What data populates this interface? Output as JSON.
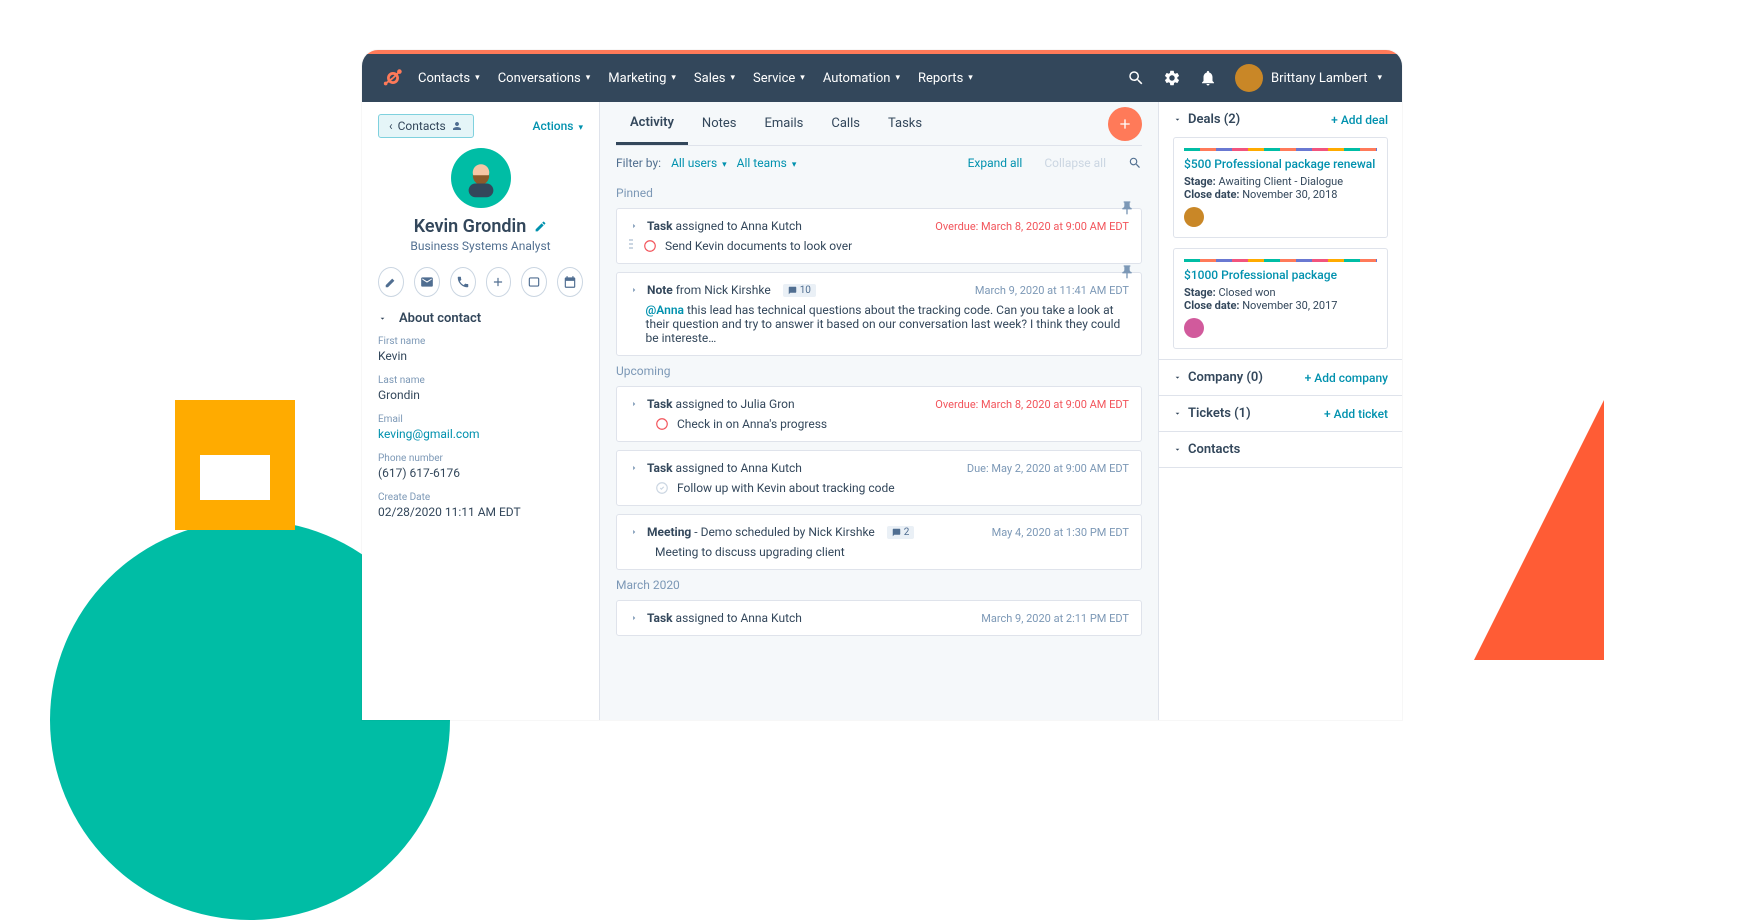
{
  "nav": {
    "items": [
      "Contacts",
      "Conversations",
      "Marketing",
      "Sales",
      "Service",
      "Automation",
      "Reports"
    ],
    "user": "Brittany Lambert"
  },
  "left": {
    "back": "Contacts",
    "actions": "Actions",
    "name": "Kevin Grondin",
    "title": "Business Systems Analyst",
    "section": "About contact",
    "fields": [
      {
        "label": "First name",
        "value": "Kevin"
      },
      {
        "label": "Last name",
        "value": "Grondin"
      },
      {
        "label": "Email",
        "value": "keving@gmail.com",
        "link": true
      },
      {
        "label": "Phone number",
        "value": "(617) 617-6176"
      },
      {
        "label": "Create Date",
        "value": "02/28/2020 11:11 AM EDT"
      }
    ]
  },
  "mid": {
    "tabs": [
      "Activity",
      "Notes",
      "Emails",
      "Calls",
      "Tasks"
    ],
    "filter_label": "Filter by:",
    "filter_users": "All users",
    "filter_teams": "All teams",
    "expand": "Expand all",
    "collapse": "Collapse all",
    "groups": {
      "pinned": "Pinned",
      "upcoming": "Upcoming",
      "march": "March 2020"
    },
    "items": {
      "p1": {
        "pre": "Task",
        "mid": " assigned to Anna Kutch",
        "date": "Overdue: March 8, 2020 at 9:00 AM EDT",
        "body": "Send Kevin documents to look over"
      },
      "p2": {
        "pre": "Note",
        "mid": " from Nick Kirshke",
        "comments": "10",
        "date": "March 9, 2020 at 11:41 AM EDT",
        "mention": "@Anna",
        "body": " this lead has technical questions about the tracking code. Can you take a look at their question and try to answer it based on our conversation last week? I think they could be intereste…"
      },
      "u1": {
        "pre": "Task",
        "mid": " assigned to Julia Gron",
        "date": "Overdue: March 8, 2020 at 9:00 AM EDT",
        "body": "Check in on Anna's progress"
      },
      "u2": {
        "pre": "Task",
        "mid": " assigned to Anna Kutch",
        "date": "Due: May 2, 2020 at 9:00 AM EDT",
        "body": "Follow up with Kevin about tracking code"
      },
      "u3": {
        "pre": "Meeting",
        "mid": " - Demo scheduled by Nick Kirshke",
        "comments": "2",
        "date": "May 4, 2020 at 1:30 PM EDT",
        "body": "Meeting to discuss upgrading client"
      },
      "m1": {
        "pre": "Task",
        "mid": " assigned to Anna Kutch",
        "date": "March 9, 2020 at 2:11 PM EDT"
      }
    }
  },
  "right": {
    "deals_h": "Deals (2)",
    "add_deal": "+ Add deal",
    "deals": [
      {
        "title": "$500 Professional package renewal",
        "stage_l": "Stage:",
        "stage": " Awaiting Client - Dialogue",
        "close_l": "Close date:",
        "close": " November 30, 2018",
        "av": "#c98727"
      },
      {
        "title": "$1000 Professional package",
        "stage_l": "Stage:",
        "stage": " Closed won",
        "close_l": "Close date:",
        "close": " November 30, 2017",
        "av": "#d15a9c"
      }
    ],
    "company_h": "Company (0)",
    "add_company": "+ Add company",
    "tickets_h": "Tickets (1)",
    "add_ticket": "+ Add ticket",
    "contacts_h": "Contacts"
  }
}
